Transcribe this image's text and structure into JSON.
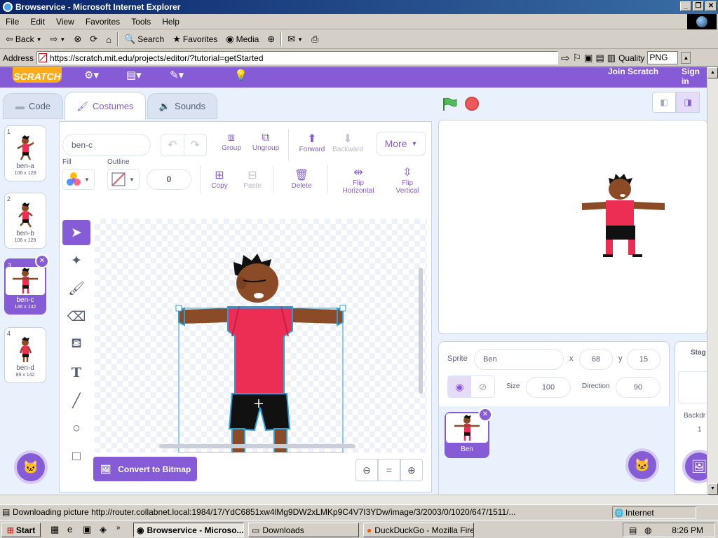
{
  "window": {
    "title": "Browservice - Microsoft Internet Explorer"
  },
  "menu": [
    "File",
    "Edit",
    "View",
    "Favorites",
    "Tools",
    "Help"
  ],
  "toolbar": {
    "back": "Back",
    "search": "Search",
    "favorites": "Favorites",
    "media": "Media"
  },
  "address": {
    "label": "Address",
    "url": "https://scratch.mit.edu/projects/editor/?tutorial=getStarted",
    "quality_label": "Quality",
    "quality_value": "PNG"
  },
  "scratch": {
    "logo": "SCRATCH",
    "join": "Join Scratch",
    "sign_in": "Sign in",
    "tabs": {
      "code": "Code",
      "costumes": "Costumes",
      "sounds": "Sounds"
    },
    "costumes": [
      {
        "num": "1",
        "name": "ben-a",
        "size": "106 x 128"
      },
      {
        "num": "2",
        "name": "ben-b",
        "size": "106 x 129"
      },
      {
        "num": "3",
        "name": "ben-c",
        "size": "146 x 142"
      },
      {
        "num": "4",
        "name": "ben-d",
        "size": "89 x 142"
      }
    ],
    "editor": {
      "costume_name": "ben-c",
      "group": "Group",
      "ungroup": "Ungroup",
      "forward": "Forward",
      "backward": "Backward",
      "more": "More",
      "fill": "Fill",
      "outline": "Outline",
      "outline_width": "0",
      "copy": "Copy",
      "paste": "Paste",
      "delete": "Delete",
      "flip_h": "Flip\nHorizontal",
      "flip_v": "Flip\nVertical",
      "convert": "Convert to Bitmap"
    },
    "sprite_info": {
      "sprite_label": "Sprite",
      "sprite_name": "Ben",
      "x_label": "x",
      "x": "68",
      "y_label": "y",
      "y": "15",
      "size_label": "Size",
      "size": "100",
      "direction_label": "Direction",
      "direction": "90"
    },
    "sprite_tile": "Ben",
    "stage_panel": {
      "title": "Stag",
      "backdrops": "Backdr",
      "count": "1"
    }
  },
  "status": {
    "text": "Downloading picture http://router.collabnet.local:1984/17/YdC6851xw4lMg9DW2xLMKp9C4V7I3YDw/image/3/2003/0/1020/647/1511/...",
    "zone": "Internet"
  },
  "taskbar": {
    "start": "Start",
    "tasks": [
      "Browservice - Microso...",
      "Downloads",
      "DuckDuckGo - Mozilla Fire..."
    ],
    "clock": "8:26 PM"
  },
  "colors": {
    "scratch_purple": "#855cd6",
    "accent_blue": "#4c97ff",
    "stop_red": "#ec5959",
    "flag_green": "#4cbf56"
  }
}
